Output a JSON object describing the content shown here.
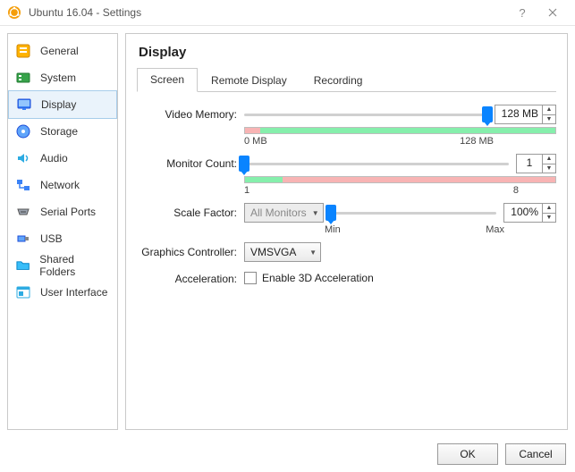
{
  "window": {
    "title": "Ubuntu 16.04 - Settings"
  },
  "sidebar": {
    "items": [
      {
        "label": "General"
      },
      {
        "label": "System"
      },
      {
        "label": "Display"
      },
      {
        "label": "Storage"
      },
      {
        "label": "Audio"
      },
      {
        "label": "Network"
      },
      {
        "label": "Serial Ports"
      },
      {
        "label": "USB"
      },
      {
        "label": "Shared Folders"
      },
      {
        "label": "User Interface"
      }
    ]
  },
  "page": {
    "title": "Display",
    "tabs": [
      {
        "label": "Screen"
      },
      {
        "label": "Remote Display"
      },
      {
        "label": "Recording"
      }
    ],
    "videoMemory": {
      "label": "Video Memory:",
      "min": "0 MB",
      "max": "128 MB",
      "value": "128 MB"
    },
    "monitorCount": {
      "label": "Monitor Count:",
      "min": "1",
      "max": "8",
      "value": "1"
    },
    "scaleFactor": {
      "label": "Scale Factor:",
      "dropdown": "All Monitors",
      "min": "Min",
      "max": "Max",
      "value": "100%"
    },
    "graphicsController": {
      "label": "Graphics Controller:",
      "value": "VMSVGA"
    },
    "acceleration": {
      "label": "Acceleration:",
      "checkbox": "Enable 3D Acceleration"
    }
  },
  "footer": {
    "ok": "OK",
    "cancel": "Cancel"
  }
}
